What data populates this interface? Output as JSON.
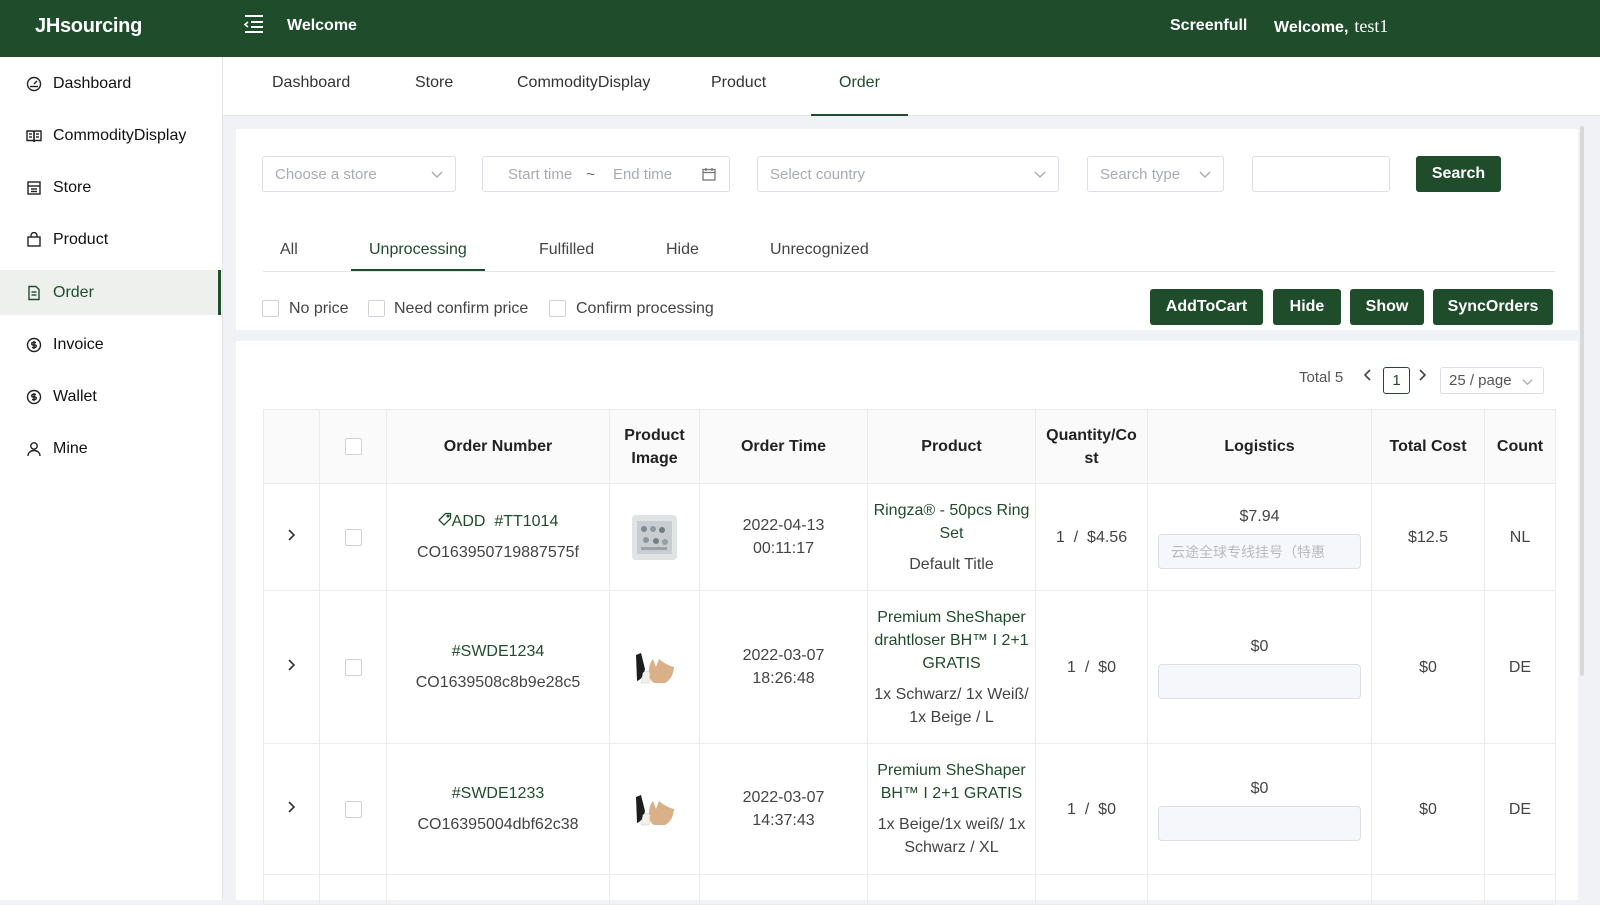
{
  "app": {
    "logo": "JHsourcing",
    "page_title": "Welcome",
    "screenfull": "Screenfull",
    "welcome": "Welcome,",
    "username": "test1"
  },
  "sidebar": {
    "items": [
      {
        "label": "Dashboard",
        "icon": "dashboard-icon"
      },
      {
        "label": "CommodityDisplay",
        "icon": "book-icon"
      },
      {
        "label": "Store",
        "icon": "store-icon"
      },
      {
        "label": "Product",
        "icon": "bag-icon"
      },
      {
        "label": "Order",
        "icon": "document-icon",
        "active": true
      },
      {
        "label": "Invoice",
        "icon": "dollar-circle-icon"
      },
      {
        "label": "Wallet",
        "icon": "dollar-circle-icon"
      },
      {
        "label": "Mine",
        "icon": "user-icon"
      }
    ]
  },
  "top_tabs": [
    "Dashboard",
    "Store",
    "CommodityDisplay",
    "Product",
    "Order"
  ],
  "filters": {
    "store_placeholder": "Choose a store",
    "start_placeholder": "Start time",
    "range_sep": "~",
    "end_placeholder": "End time",
    "country_placeholder": "Select country",
    "search_type_placeholder": "Search type",
    "search_value": "",
    "search_button": "Search"
  },
  "status_tabs": [
    "All",
    "Unprocessing",
    "Fulfilled",
    "Hide",
    "Unrecognized"
  ],
  "options": {
    "no_price": "No price",
    "need_confirm_price": "Need confirm price",
    "confirm_processing": "Confirm processing"
  },
  "actions": {
    "add_to_cart": "AddToCart",
    "hide": "Hide",
    "show": "Show",
    "sync_orders": "SyncOrders"
  },
  "pagination": {
    "total": "Total 5",
    "current_page": "1",
    "per_page": "25 / page"
  },
  "table": {
    "columns": [
      "Order Number",
      "Product Image",
      "Order Time",
      "Product",
      "Quantity/Co st",
      "Logistics",
      "Total Cost",
      "Count"
    ],
    "rows": [
      {
        "tag": "ADD",
        "order_no": "#TT1014",
        "order_id": "CO163950719887575f",
        "date": "2022-04-13",
        "time": "00:11:17",
        "product": "Ringza® - 50pcs Ring Set",
        "variant": "Default Title",
        "qty": "1",
        "cost": "$4.56",
        "logistics_price": "$7.94",
        "logistics_value": "云途全球专线挂号（特惠",
        "total": "$12.5",
        "country": "NL",
        "image": "ring-set-thumbnail"
      },
      {
        "tag": "",
        "order_no": "#SWDE1234",
        "order_id": "CO1639508c8b9e28c5",
        "date": "2022-03-07",
        "time": "18:26:48",
        "product": "Premium SheShaper drahtloser BH™ I 2+1 GRATIS",
        "variant": "1x Schwarz/ 1x Weiß/ 1x Beige / L",
        "qty": "1",
        "cost": "$0",
        "logistics_price": "$0",
        "logistics_value": "",
        "total": "$0",
        "country": "DE",
        "image": "bra-thumbnail"
      },
      {
        "tag": "",
        "order_no": "#SWDE1233",
        "order_id": "CO16395004dbf62c38",
        "date": "2022-03-07",
        "time": "14:37:43",
        "product": "Premium SheShaper BH™ I 2+1 GRATIS",
        "variant": "1x Beige/1x weiß/ 1x Schwarz / XL",
        "qty": "1",
        "cost": "$0",
        "logistics_price": "$0",
        "logistics_value": "",
        "total": "$0",
        "country": "DE",
        "image": "bra-thumbnail"
      }
    ]
  },
  "colors": {
    "brand": "#1f4d2b",
    "page_bg": "#f0f2f5"
  }
}
